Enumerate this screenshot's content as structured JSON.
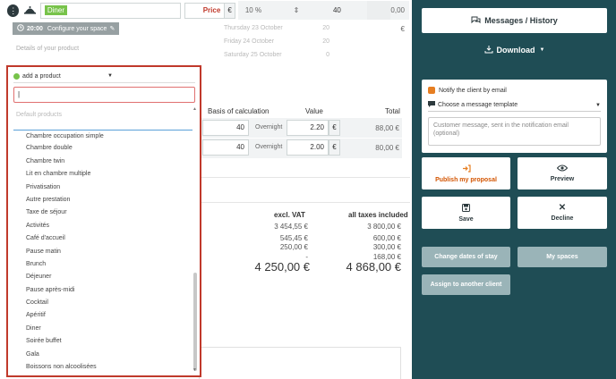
{
  "line": {
    "name": "Diner",
    "price_label": "Price",
    "currency": "€",
    "vat": "10 %",
    "vat_arrow": "⇕",
    "quantity": "40",
    "total": "0,00 €",
    "time": "20:00",
    "configure_label": "Configure your space",
    "details_placeholder": "Details of your product",
    "dates": [
      {
        "label": "Thursday 23 October",
        "qty": "20"
      },
      {
        "label": "Friday 24 October",
        "qty": "20"
      },
      {
        "label": "Saturday 25 October",
        "qty": "0"
      }
    ]
  },
  "table": {
    "col_basis": "Basis of calculation",
    "col_value": "Value",
    "col_total": "Total",
    "rows": [
      {
        "qty": "40",
        "unit": "Overnight",
        "value": "2.20",
        "total": "88,00 €"
      },
      {
        "qty": "40",
        "unit": "Overnight",
        "value": "2.00",
        "total": "80,00 €"
      }
    ]
  },
  "totals": {
    "excl_label": "excl. VAT",
    "incl_label": "all taxes included",
    "excl_values": [
      "3 454,55 €",
      "545,45 €",
      "250,00 €",
      "-"
    ],
    "incl_values": [
      "3 800,00 €",
      "600,00 €",
      "300,00 €",
      "168,00 €"
    ],
    "excl_total": "4 250,00 €",
    "incl_total": "4 868,00 €"
  },
  "dropdown": {
    "head_label": "add a product",
    "search_value": "|",
    "category": "Default products",
    "items": [
      "Chambre occupation simple",
      "Chambre double",
      "Chambre twin",
      "Lit en chambre multiple",
      "Privatisation",
      "Autre prestation",
      "Taxe de séjour",
      "Activités",
      "Café d'accueil",
      "Pause matin",
      "Brunch",
      "Déjeuner",
      "Pause après-midi",
      "Cocktail",
      "Apéritif",
      "Diner",
      "Soirée buffet",
      "Gala",
      "Boissons non alcoolisées"
    ]
  },
  "panel": {
    "messages_history": "Messages / History",
    "download": "Download",
    "notify_label": "Notify the client by email",
    "template_placeholder": "Choose a message template",
    "message_placeholder": "Customer message, sent in the notification email (optional)",
    "publish": "Publish my proposal",
    "preview": "Preview",
    "save": "Save",
    "decline": "Decline",
    "change_dates": "Change dates of stay",
    "my_spaces": "My spaces",
    "assign_client": "Assign to another client"
  },
  "colors": {
    "panel_bg": "#1f4d55",
    "accent_orange": "#e67e22",
    "accent_green": "#77c34a",
    "accent_red": "#c0392b"
  }
}
